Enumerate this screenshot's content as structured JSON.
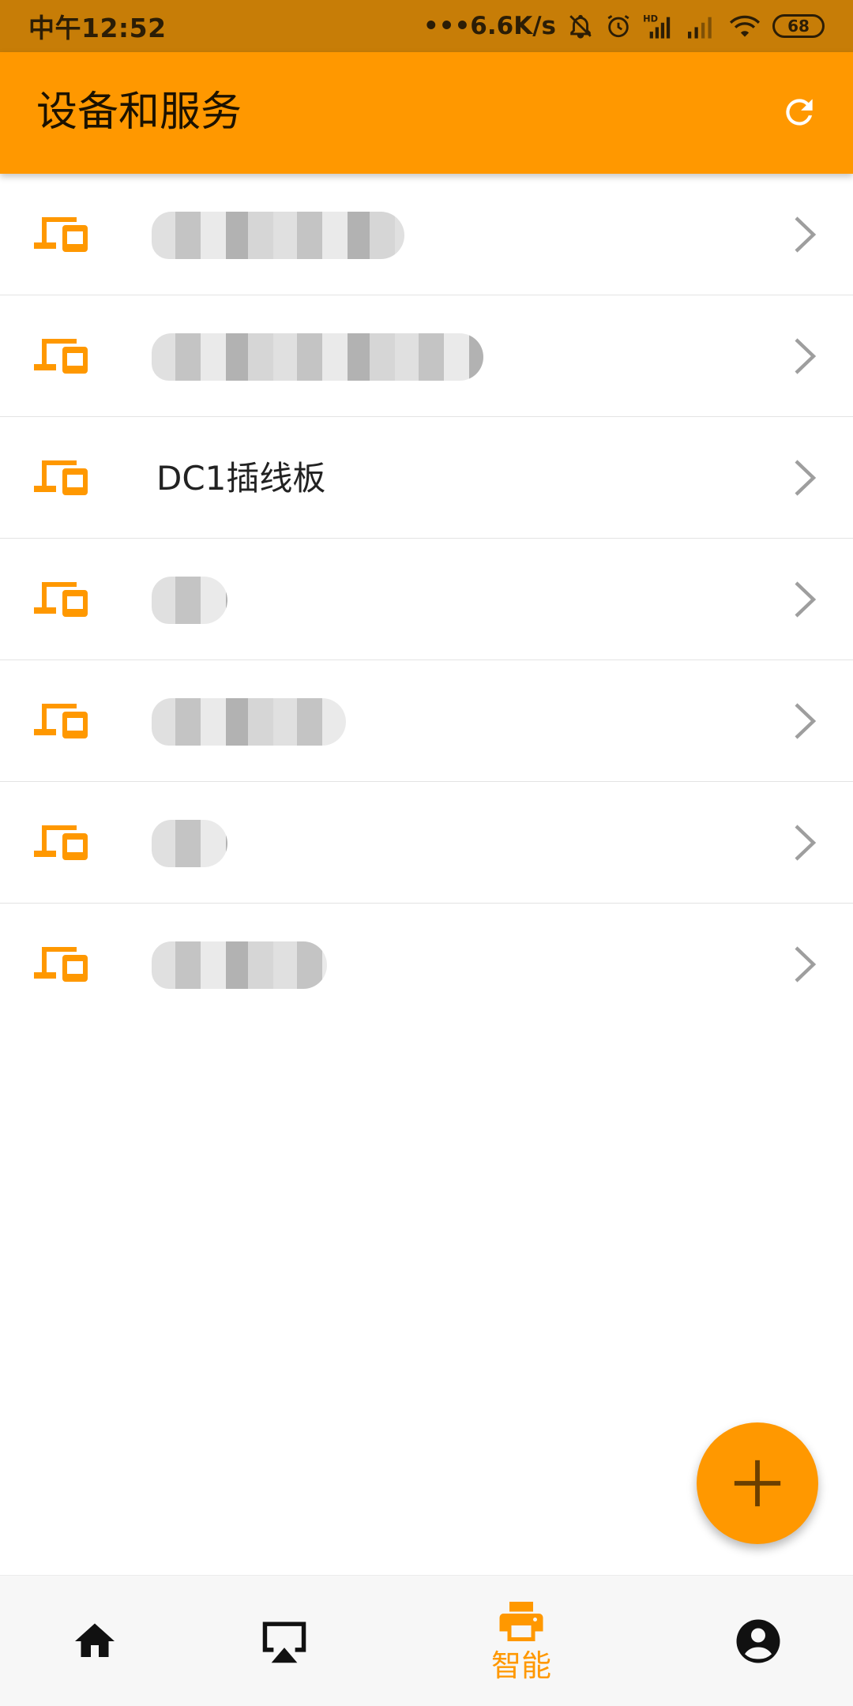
{
  "status_bar": {
    "time": "中午12:52",
    "network_speed": "•••6.6K/s",
    "battery": "68"
  },
  "app_bar": {
    "title": "设备和服务",
    "refresh_icon": "refresh-icon"
  },
  "devices": [
    {
      "name": "",
      "blurred": true,
      "icon": "devices-icon"
    },
    {
      "name": "",
      "blurred": true,
      "icon": "devices-icon"
    },
    {
      "name": "DC1插线板",
      "blurred": false,
      "icon": "devices-icon"
    },
    {
      "name": "",
      "blurred": true,
      "icon": "devices-icon"
    },
    {
      "name": "",
      "blurred": true,
      "icon": "devices-icon"
    },
    {
      "name": "",
      "blurred": true,
      "icon": "devices-icon"
    },
    {
      "name": "",
      "blurred": true,
      "icon": "devices-icon"
    }
  ],
  "fab": {
    "icon": "plus-icon"
  },
  "bottom_nav": {
    "items": [
      {
        "icon": "home-icon",
        "label": ""
      },
      {
        "icon": "cast-icon",
        "label": ""
      },
      {
        "icon": "printer-icon",
        "label": "智能",
        "active": true
      },
      {
        "icon": "account-icon",
        "label": ""
      }
    ]
  },
  "colors": {
    "accent": "#ff9800",
    "status_bar": "#c77d07",
    "text": "#222222",
    "divider": "#e3e3e3"
  }
}
